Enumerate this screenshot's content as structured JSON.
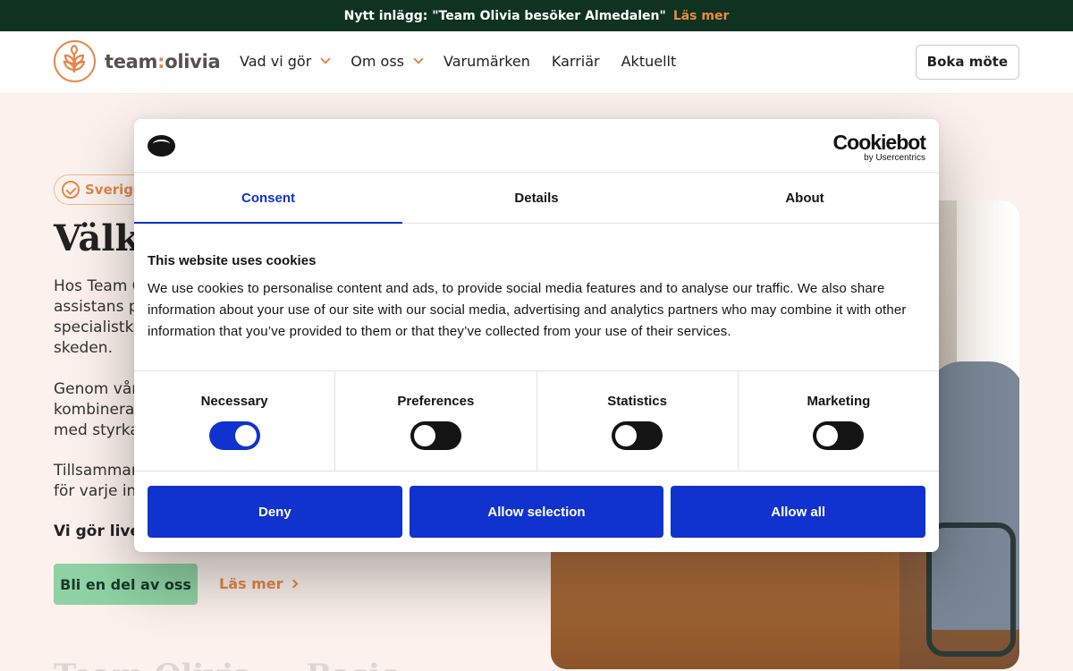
{
  "announcement": {
    "text": "Nytt inlägg: \"Team Olivia besöker Almedalen\"",
    "link": "Läs mer"
  },
  "header": {
    "logo_prefix": "team",
    "logo_colon": ":",
    "logo_suffix": "olivia",
    "nav": [
      "Vad vi gör",
      "Om oss",
      "Varumärken",
      "Karriär",
      "Aktuellt"
    ],
    "cta": "Boka möte"
  },
  "hero": {
    "badge": "Sverige",
    "title": "Välko",
    "p1": "Hos Team O\nassistans p\nspecialistkc\nskeden.",
    "p2": "Genom vår\nkombinera\nmed styrka",
    "p3": "Tillsamman\nför varje in",
    "strong": "Vi gör live",
    "primary_cta": "Bli en del av oss",
    "secondary_cta": "Läs mer",
    "bottom_heading": "Team Olivia ... Basic"
  },
  "cookie_dialog": {
    "brand": "Cookiebot",
    "brand_sub": "by Usercentrics",
    "tabs": [
      "Consent",
      "Details",
      "About"
    ],
    "active_tab": "Consent",
    "heading": "This website uses cookies",
    "body": "We use cookies to personalise content and ads, to provide social media features and to analyse our traffic. We also share information about your use of our site with our social media, advertising and analytics partners who may combine it with other information that you’ve provided to them or that they’ve collected from your use of their services.",
    "preferences": [
      {
        "label": "Necessary",
        "checked": true
      },
      {
        "label": "Preferences",
        "checked": false
      },
      {
        "label": "Statistics",
        "checked": false
      },
      {
        "label": "Marketing",
        "checked": false
      }
    ],
    "buttons": {
      "deny": "Deny",
      "selection": "Allow selection",
      "all": "Allow all"
    }
  },
  "colors": {
    "accent": "#e5874a",
    "dark_green": "#0f3320",
    "cookie_blue": "#1032cf",
    "mint": "#8fd3a4"
  }
}
